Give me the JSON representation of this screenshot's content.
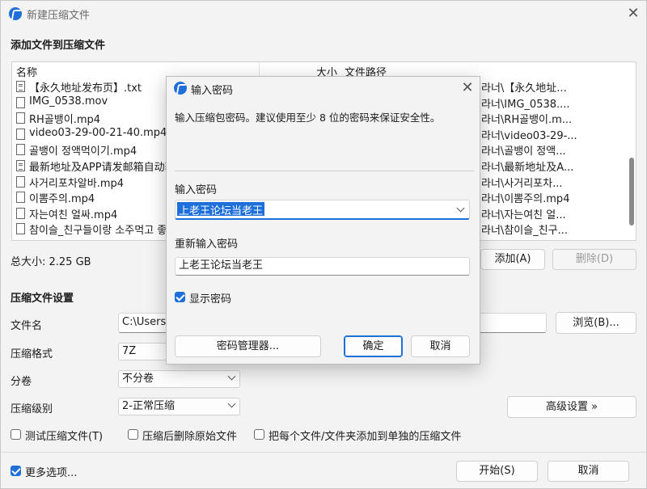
{
  "main_window": {
    "title": "新建压缩文件",
    "section_add": "添加文件到压缩文件",
    "list": {
      "col_name": "名称",
      "col_size": "大小",
      "col_path": "文件路径",
      "rows": [
        {
          "name": "【永久地址发布页】.txt",
          "path": "라너\\【永久地址...",
          "type": "txt"
        },
        {
          "name": "IMG_0538.mov",
          "path": "라너\\IMG_0538....",
          "type": "file"
        },
        {
          "name": "RH골뱅이.mp4",
          "path": "라너\\RH골뱅이.m...",
          "type": "file"
        },
        {
          "name": "video03-29-00-21-40.mp4",
          "path": "라너\\video03-29-...",
          "type": "file"
        },
        {
          "name": "골뱅이 정액먹이기.mp4",
          "path": "라너\\골뱅이 정액...",
          "type": "file"
        },
        {
          "name": "最新地址及APP请发邮箱自动获",
          "path": "라너\\最新地址及A...",
          "type": "txt"
        },
        {
          "name": "사거리포차알바.mp4",
          "path": "라너\\사거리포차...",
          "type": "file"
        },
        {
          "name": "이뽐주의.mp4",
          "path": "라너\\이뽐주의.mp4",
          "type": "file"
        },
        {
          "name": "자는여친 얼싸.mp4",
          "path": "라너\\자는여친 얼...",
          "type": "file"
        },
        {
          "name": "참이슬_친구들이랑 소주먹고 좋",
          "path": "라너\\참이슬_친구...",
          "type": "file"
        }
      ]
    },
    "total_size": "总大小: 2.25 GB",
    "add_button": "添加(A)",
    "delete_button": "删除(D)",
    "section_settings": "压缩文件设置",
    "filename_label": "文件名",
    "filename_value": "C:\\Users\\",
    "browse_button": "浏览(B)...",
    "format_label": "压缩格式",
    "format_value": "7Z",
    "split_label": "分卷",
    "split_value": "不分卷",
    "level_label": "压缩级别",
    "level_value": "2-正常压缩",
    "advanced_button": "高级设置 »",
    "test_checkbox": "测试压缩文件(T)",
    "delete_after_checkbox": "压缩后删除原始文件",
    "separate_checkbox": "把每个文件/文件夹添加到单独的压缩文件",
    "more_options": "更多选项...",
    "start_button": "开始(S)",
    "cancel_button": "取消"
  },
  "dialog": {
    "title": "输入密码",
    "description": "输入压缩包密码。建议使用至少 8 位的密码来保证安全性。",
    "password_label": "输入密码",
    "password_value": "上老王论坛当老王",
    "reenter_label": "重新输入密码",
    "reenter_value": "上老王论坛当老王",
    "show_password": "显示密码",
    "show_password_checked": true,
    "manager_button": "密码管理器...",
    "ok_button": "确定",
    "cancel_button": "取消"
  },
  "colors": {
    "accent": "#1e6fd9"
  }
}
